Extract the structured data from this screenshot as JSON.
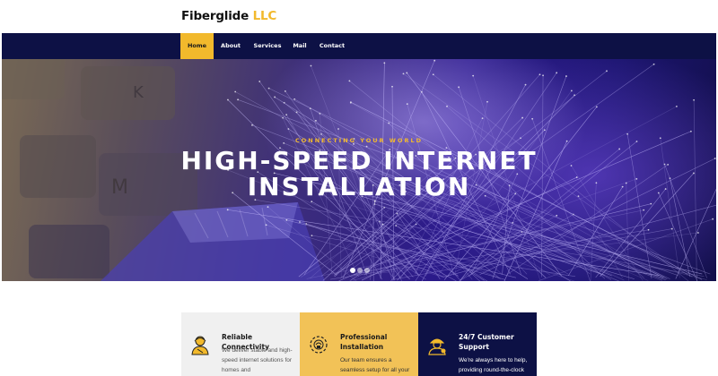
{
  "brand": {
    "name": "Fiberglide",
    "suffix": "LLC",
    "accent_color": "#f2b92c"
  },
  "nav": {
    "items": [
      "Home",
      "About",
      "Services",
      "Mail",
      "Contact"
    ],
    "active": "Home",
    "background": "#0d1145"
  },
  "hero": {
    "eyebrow": "CONNECTING YOUR WORLD",
    "title_line1": "HIGH-SPEED INTERNET",
    "title_line2": "INSTALLATION",
    "slides": 3,
    "active_slide": 1
  },
  "features": [
    {
      "icon": "worker-icon",
      "title": "Reliable Connectivity",
      "text": "We deliver stable and high-speed internet solutions for homes and"
    },
    {
      "icon": "gear-worker-icon",
      "title_line1": "Professional",
      "title_line2": "Installation",
      "text": "Our team ensures a seamless setup for all your"
    },
    {
      "icon": "support-worker-icon",
      "title_line1": "24/7 Customer",
      "title_line2": "Support",
      "text": "We're always here to help, providing round-the-clock"
    }
  ]
}
